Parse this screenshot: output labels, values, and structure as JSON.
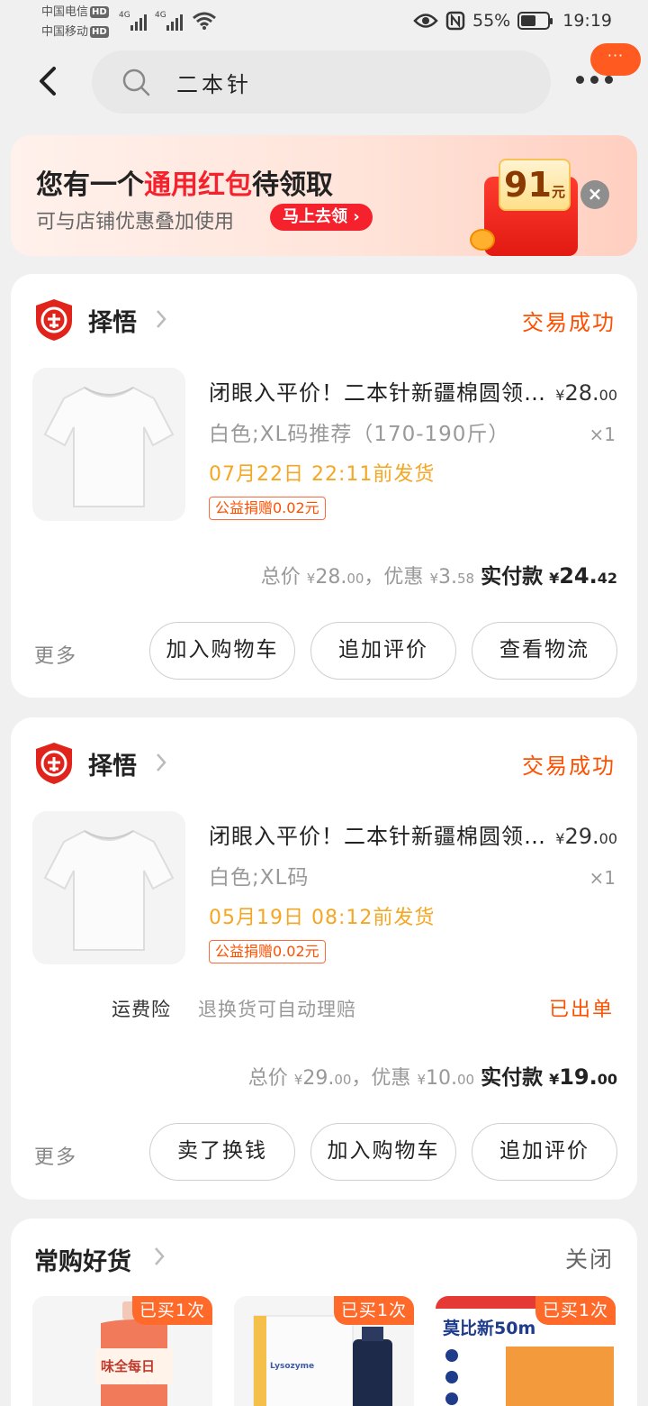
{
  "status_bar": {
    "carrier1": "中国电信",
    "carrier2": "中国移动",
    "hd": "HD",
    "net1": "4G",
    "net2": "4G",
    "battery": "55%",
    "battery_level": 0.55,
    "time": "19:19"
  },
  "nav": {
    "search_value": "二本针",
    "bubble": "···"
  },
  "banner": {
    "title_a": "您有一个",
    "title_hl": "通用红包",
    "title_b": "待领取",
    "subtitle": "可与店铺优惠叠加使用",
    "claim_button": "马上去领",
    "amount": "91",
    "amount_unit": "元",
    "close": "×"
  },
  "orders": [
    {
      "shop": "择悟",
      "status": "交易成功",
      "title": "闭眼入平价！二本针新疆棉圆领短袖T恤",
      "price_cur": "¥",
      "price_int": "28.",
      "price_dec": "00",
      "sku": "白色;XL码推荐（170-190斤）",
      "qty": "×1",
      "ship": "07月22日 22:11前发货",
      "charity": "公益捐赠0.02元",
      "total_label": "总价",
      "total_cur": "¥",
      "total_int": "28.",
      "total_dec": "00",
      "discount_label": "，优惠",
      "discount_cur": "¥",
      "discount_int": "3.",
      "discount_dec": "58",
      "paid_label": "实付款",
      "paid_cur": "¥",
      "paid_int": "24.",
      "paid_dec": "42",
      "more": "更多",
      "buttons": [
        "加入购物车",
        "追加评价",
        "查看物流"
      ]
    },
    {
      "shop": "择悟",
      "status": "交易成功",
      "title": "闭眼入平价！二本针新疆棉圆领短袖T恤",
      "price_cur": "¥",
      "price_int": "29.",
      "price_dec": "00",
      "sku": "白色;XL码",
      "qty": "×1",
      "ship": "05月19日 08:12前发货",
      "charity": "公益捐赠0.02元",
      "insurance_label": "运费险",
      "insurance_desc": "退换货可自动理赔",
      "insurance_status": "已出单",
      "total_label": "总价",
      "total_cur": "¥",
      "total_int": "29.",
      "total_dec": "00",
      "discount_label": "，优惠",
      "discount_cur": "¥",
      "discount_int": "10.",
      "discount_dec": "00",
      "paid_label": "实付款",
      "paid_cur": "¥",
      "paid_int": "19.",
      "paid_dec": "00",
      "more": "更多",
      "buttons": [
        "卖了换钱",
        "加入购物车",
        "追加评价"
      ]
    }
  ],
  "frequent": {
    "title": "常购好货",
    "close": "关闭",
    "items": [
      {
        "tag": "已买1次",
        "name": "味全每日"
      },
      {
        "tag": "已买1次",
        "name": "Lysozyme"
      },
      {
        "tag": "已买1次",
        "name": "莫比新50m"
      }
    ]
  },
  "colors": {
    "accent": "#ff5000",
    "red": "#f5222d",
    "ship": "#f5a623"
  }
}
